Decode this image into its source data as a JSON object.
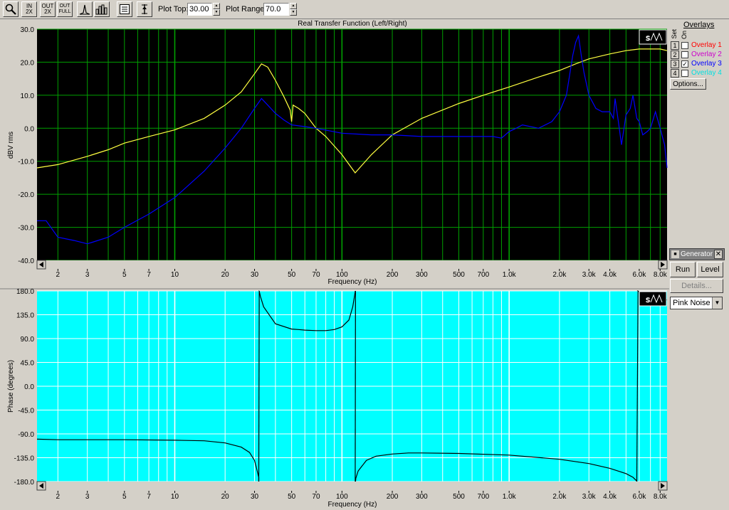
{
  "toolbar": {
    "buttons": [
      {
        "id": "zoom",
        "icon": "magnifier-icon",
        "label": ""
      },
      {
        "id": "zoom-in-2x",
        "icon": "zoom-in-2x-icon",
        "label": "IN\n2X"
      },
      {
        "id": "zoom-out-2x",
        "icon": "zoom-out-2x-icon",
        "label": "OUT\n2X"
      },
      {
        "id": "zoom-out-full",
        "icon": "zoom-out-full-icon",
        "label": "OUT\nFULL"
      },
      {
        "id": "peak",
        "icon": "peak-icon",
        "label": ""
      },
      {
        "id": "bars",
        "icon": "bars-icon",
        "label": ""
      },
      {
        "id": "legend",
        "icon": "legend-icon",
        "label": ""
      },
      {
        "id": "cursor",
        "icon": "cursor-icon",
        "label": ""
      }
    ],
    "plot_top_label": "Plot Top:",
    "plot_top_value": "30.00",
    "plot_range_label": "Plot Range:",
    "plot_range_value": "70.0"
  },
  "overlays": {
    "header": "Overlays",
    "col_set": "Set",
    "col_on": "On",
    "items": [
      {
        "num": "1",
        "name": "Overlay 1",
        "checked": false,
        "color": "#ff0000"
      },
      {
        "num": "2",
        "name": "Overlay 2",
        "checked": false,
        "color": "#cc00cc"
      },
      {
        "num": "3",
        "name": "Overlay 3",
        "checked": true,
        "color": "#0000ff"
      },
      {
        "num": "4",
        "name": "Overlay 4",
        "checked": false,
        "color": "#00e0e0"
      }
    ],
    "options_label": "Options..."
  },
  "generator": {
    "title": "Generator",
    "run_label": "Run",
    "level_label": "Level",
    "details_label": "Details...",
    "signal_value": "Pink Noise"
  },
  "chart_data": [
    {
      "type": "line",
      "title": "Real Transfer Function (Left/Right)",
      "xlabel": "Frequency (Hz)",
      "ylabel": "dBV rms",
      "x_scale": "log",
      "xlim": [
        1.5,
        8800
      ],
      "ylim": [
        -40,
        30
      ],
      "y_ticks": [
        30,
        20,
        10,
        0,
        -10,
        -20,
        -30,
        -40
      ],
      "y_tick_labels": [
        "30.0",
        "20.0",
        "10.0",
        "0.0",
        "-10.0",
        "-20.0",
        "-30.0",
        "-40.0"
      ],
      "x_ticks": [
        2,
        3,
        5,
        7,
        10,
        20,
        30,
        50,
        70,
        100,
        200,
        300,
        500,
        700,
        1000,
        2000,
        3000,
        4000,
        6000,
        8000
      ],
      "x_tick_labels": [
        "2",
        "3",
        "5",
        "7",
        "10",
        "20",
        "30",
        "50",
        "70",
        "100",
        "200",
        "300",
        "500",
        "700",
        "1.0k",
        "2.0k",
        "3.0k",
        "4.0k",
        "6.0k",
        "8.0k"
      ],
      "background": "#000000",
      "grid_color": "#00a000",
      "grid": true,
      "series": [
        {
          "color": "#ffff40",
          "x": [
            1.5,
            2,
            3,
            4,
            5,
            7,
            10,
            15,
            20,
            25,
            30,
            33,
            36,
            40,
            45,
            49,
            50,
            51,
            55,
            60,
            70,
            80,
            100,
            120,
            150,
            200,
            300,
            500,
            700,
            1000,
            1500,
            2000,
            2500,
            3000,
            4000,
            5000,
            6000,
            7000,
            8000,
            8800
          ],
          "y": [
            -12,
            -11,
            -8.5,
            -6.5,
            -4.5,
            -2.5,
            -0.5,
            3,
            7,
            11,
            16.5,
            19.5,
            18.5,
            14.5,
            9.5,
            5.5,
            2,
            7,
            6,
            4.5,
            0,
            -2.5,
            -8,
            -13.5,
            -8,
            -2,
            3,
            7.5,
            10,
            12.5,
            15.5,
            17.5,
            19.5,
            21,
            22.5,
            23.5,
            24,
            24,
            24,
            23.5
          ]
        },
        {
          "color": "#0000ff",
          "x": [
            1.5,
            1.7,
            2,
            2.5,
            3,
            4,
            5,
            7,
            10,
            15,
            20,
            25,
            30,
            33,
            36,
            40,
            45,
            50,
            60,
            70,
            100,
            150,
            200,
            300,
            500,
            700,
            800,
            900,
            1000,
            1100,
            1200,
            1500,
            1800,
            2000,
            2200,
            2400,
            2500,
            2600,
            2700,
            2800,
            3000,
            3300,
            3600,
            4000,
            4200,
            4300,
            4500,
            4700,
            5000,
            5300,
            5500,
            5800,
            6000,
            6300,
            6700,
            7000,
            7500,
            8000,
            8500,
            8800
          ],
          "y": [
            -28,
            -28,
            -33,
            -34,
            -35,
            -33,
            -30,
            -26,
            -21,
            -13,
            -6,
            0,
            6,
            9,
            7,
            4.5,
            2.5,
            1,
            0.5,
            0,
            -1.5,
            -2,
            -2,
            -2.5,
            -2.5,
            -2.5,
            -2.5,
            -3,
            -1,
            0,
            1,
            0,
            2,
            5,
            10,
            22,
            26,
            28,
            22,
            17,
            10,
            6,
            5,
            5,
            3,
            9,
            2,
            -5,
            4,
            6,
            10,
            3,
            2,
            -2,
            -1,
            0,
            5,
            0,
            -5,
            -12
          ]
        }
      ]
    },
    {
      "type": "line",
      "xlabel": "Frequency (Hz)",
      "ylabel": "Phase (degrees)",
      "x_scale": "log",
      "xlim": [
        1.5,
        8800
      ],
      "ylim": [
        -180,
        180
      ],
      "y_ticks": [
        180,
        135,
        90,
        45,
        0,
        -45,
        -90,
        -135,
        -180
      ],
      "y_tick_labels": [
        "180.0",
        "135.0",
        "90.0",
        "45.0",
        "0.0",
        "-45.0",
        "-90.0",
        "-135.0",
        "-180.0"
      ],
      "x_ticks": [
        2,
        3,
        5,
        7,
        10,
        20,
        30,
        50,
        70,
        100,
        200,
        300,
        500,
        700,
        1000,
        2000,
        3000,
        4000,
        6000,
        8000
      ],
      "x_tick_labels": [
        "2",
        "3",
        "5",
        "7",
        "10",
        "20",
        "30",
        "50",
        "70",
        "100",
        "200",
        "300",
        "500",
        "700",
        "1.0k",
        "2.0k",
        "3.0k",
        "4.0k",
        "6.0k",
        "8.0k"
      ],
      "background": "#00ffff",
      "grid_color": "#ffffff",
      "grid": true,
      "series": [
        {
          "color": "#000000",
          "x": [
            1.5,
            2,
            5,
            10,
            15,
            20,
            25,
            28,
            30,
            31.8,
            32,
            32.5,
            34,
            40,
            50,
            55,
            60,
            70,
            80,
            90,
            100,
            110,
            116,
            120,
            120.5,
            121,
            125,
            140,
            160,
            200,
            250,
            300,
            500,
            1000,
            2000,
            3000,
            4000,
            5000,
            5500,
            5800,
            5900,
            6000,
            7000,
            8800
          ],
          "y": [
            -100,
            -101,
            -101,
            -102,
            -103,
            -107,
            -115,
            -125,
            -140,
            -172,
            180,
            170,
            150,
            118,
            108,
            107,
            106,
            105,
            105,
            107,
            112,
            125,
            150,
            178,
            -180,
            -174,
            -160,
            -140,
            -132,
            -128,
            -126,
            -126,
            -127,
            -130,
            -138,
            -146,
            -155,
            -165,
            -172,
            -179,
            180,
            178,
            170,
            163
          ]
        }
      ]
    }
  ]
}
